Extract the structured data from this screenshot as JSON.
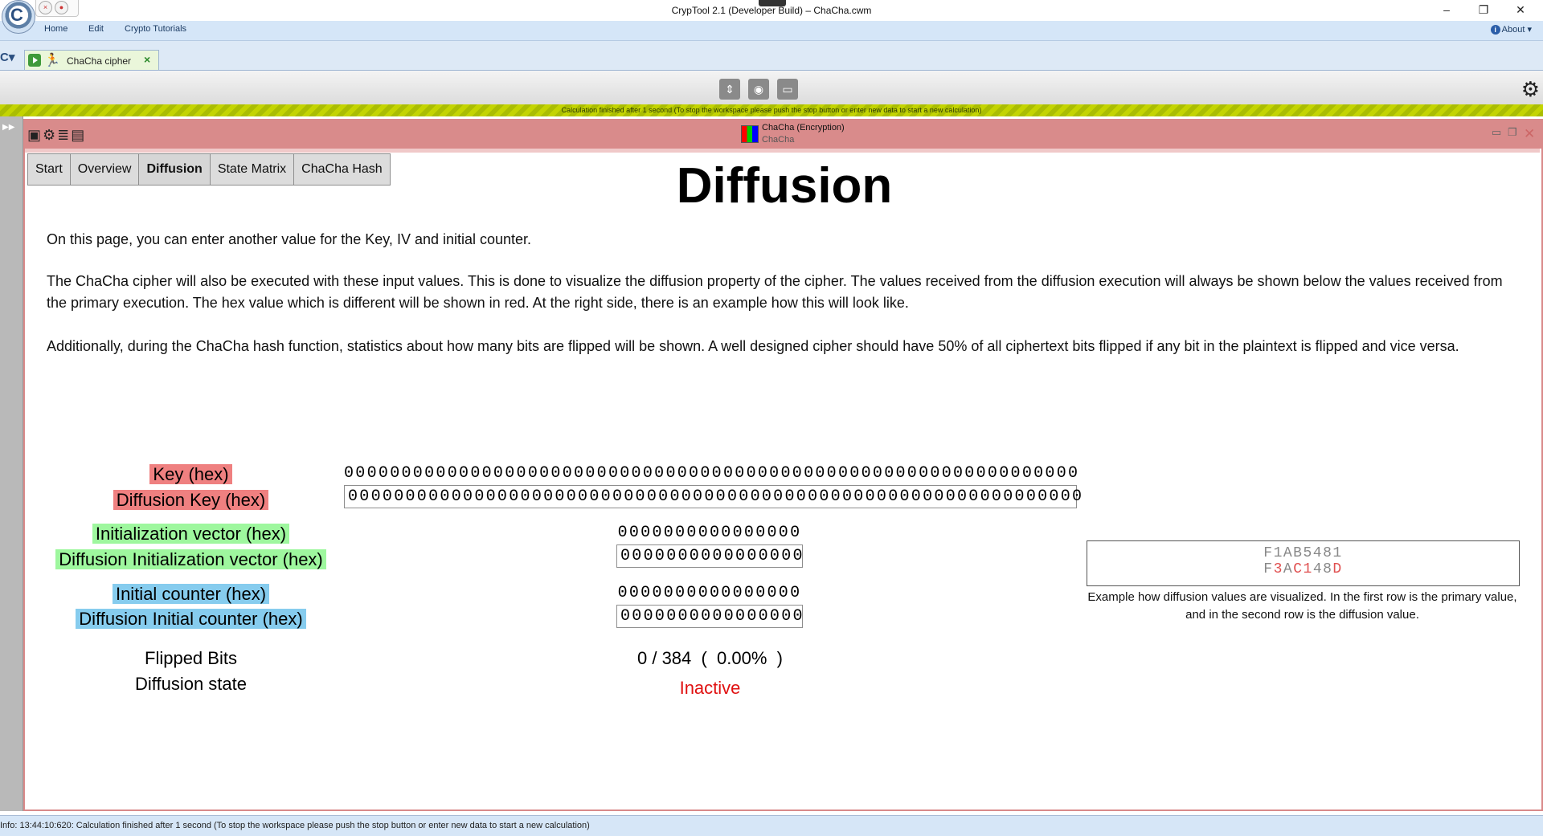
{
  "window": {
    "title": "CrypTool 2.1 (Developer Build) – ChaCha.cwm"
  },
  "menu": {
    "items": [
      "Home",
      "Edit",
      "Crypto Tutorials"
    ],
    "about": "About"
  },
  "tab": {
    "label": "ChaCha cipher"
  },
  "status_strip": "Calculation finished after 1 second (To stop the workspace please push the stop button or enter new data to start a new calculation)",
  "component": {
    "title": "ChaCha (Encryption)",
    "subtitle": "ChaCha"
  },
  "content_tabs": [
    "Start",
    "Overview",
    "Diffusion",
    "State Matrix",
    "ChaCha Hash"
  ],
  "active_tab": "Diffusion",
  "page": {
    "heading": "Diffusion",
    "para1": "On this page, you can enter another value for the Key, IV and initial counter.",
    "para2": "The ChaCha cipher will also be executed with these input values. This is done to visualize the diffusion property of the cipher. The values received from the diffusion execution will always be shown below the values received from the primary execution. The hex value which is different will be shown in red. At the right side, there is an example how this will look like.",
    "para3": "Additionally, during the ChaCha hash function, statistics about how many bits are flipped will be shown. A well designed cipher should have 50% of all ciphertext bits flipped if any bit in the plaintext is flipped and vice versa."
  },
  "fields": {
    "key_label": "Key (hex)",
    "diff_key_label": "Diffusion Key (hex)",
    "key_value": "0000000000000000000000000000000000000000000000000000000000000000",
    "diff_key_value": "0000000000000000000000000000000000000000000000000000000000000000",
    "iv_label": "Initialization vector (hex)",
    "diff_iv_label": "Diffusion Initialization vector (hex)",
    "iv_value": "0000000000000000",
    "diff_iv_value": "0000000000000000",
    "counter_label": "Initial counter (hex)",
    "diff_counter_label": "Diffusion Initial counter (hex)",
    "counter_value": "0000000000000000",
    "diff_counter_value": "0000000000000000",
    "flipped_label": "Flipped Bits",
    "state_label": "Diffusion state",
    "flipped_value": "0 / 384  (  0.00%  )",
    "state_value": "Inactive"
  },
  "example": {
    "row1": "F1AB5481",
    "row2_parts": [
      "F",
      "3",
      "A",
      "C1",
      "48",
      "D"
    ],
    "caption": "Example how diffusion values are visualized. In the first row is the primary value, and in the second row is the diffusion value."
  },
  "bottom_status": "Info: 13:44:10:620: Calculation finished after 1 second (To stop the workspace please push the stop button or enter new data to start a new calculation)",
  "colors": {
    "key_highlight": "#ef8080",
    "iv_highlight": "#9ef79e",
    "counter_highlight": "#86ccee",
    "inactive": "#e01010",
    "diff_red": "#e05050"
  },
  "icons": [
    "app-logo-icon",
    "close-circle-icon",
    "stop-icon",
    "info-icon",
    "play-icon",
    "runner-icon",
    "close-icon",
    "arrows-icon",
    "camera-icon",
    "comment-icon",
    "gear-icon",
    "image-icon",
    "list-icon",
    "clipboard-icon",
    "component-icon",
    "minimize-icon",
    "restore-icon"
  ]
}
